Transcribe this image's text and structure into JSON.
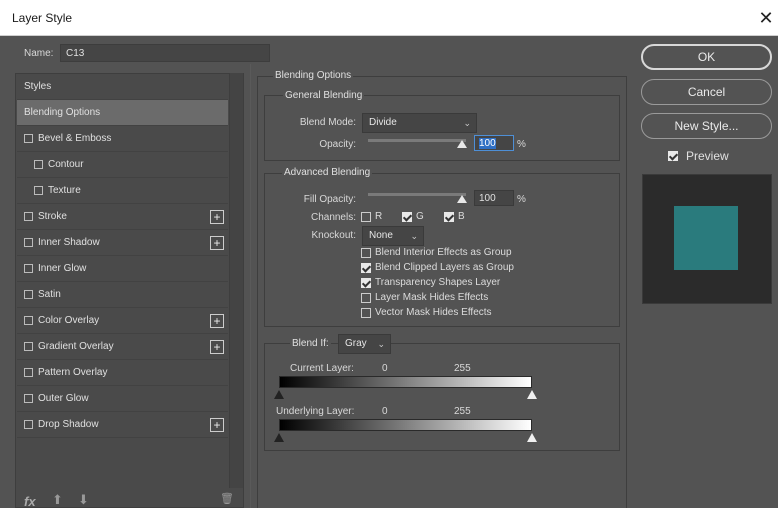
{
  "window": {
    "title": "Layer Style",
    "close_glyph": "✕"
  },
  "name_field": {
    "label": "Name:",
    "value": "C13"
  },
  "styles_list": {
    "header": "Styles",
    "items": [
      {
        "label": "Blending Options",
        "checkbox": false,
        "plus": false,
        "selected": true
      },
      {
        "label": "Bevel & Emboss",
        "checkbox": true,
        "plus": false
      },
      {
        "label": "Contour",
        "checkbox": true,
        "plus": false,
        "indent": true
      },
      {
        "label": "Texture",
        "checkbox": true,
        "plus": false,
        "indent": true
      },
      {
        "label": "Stroke",
        "checkbox": true,
        "plus": true
      },
      {
        "label": "Inner Shadow",
        "checkbox": true,
        "plus": true
      },
      {
        "label": "Inner Glow",
        "checkbox": true,
        "plus": false
      },
      {
        "label": "Satin",
        "checkbox": true,
        "plus": false
      },
      {
        "label": "Color Overlay",
        "checkbox": true,
        "plus": true
      },
      {
        "label": "Gradient Overlay",
        "checkbox": true,
        "plus": true
      },
      {
        "label": "Pattern Overlay",
        "checkbox": true,
        "plus": false
      },
      {
        "label": "Outer Glow",
        "checkbox": true,
        "plus": false
      },
      {
        "label": "Drop Shadow",
        "checkbox": true,
        "plus": true
      }
    ],
    "plus_glyph": "+"
  },
  "footer_icons": {
    "fx": "fx",
    "up": "⬆",
    "down": "⬇",
    "trash": "🗑"
  },
  "blending_options": {
    "title": "Blending Options",
    "general": {
      "title": "General Blending",
      "blend_mode_label": "Blend Mode:",
      "blend_mode_value": "Divide",
      "opacity_label": "Opacity:",
      "opacity_value": "100",
      "percent": "%"
    },
    "advanced": {
      "title": "Advanced Blending",
      "fill_opacity_label": "Fill Opacity:",
      "fill_opacity_value": "100",
      "percent": "%",
      "channels_label": "Channels:",
      "channel_r": "R",
      "channel_g": "G",
      "channel_b": "B",
      "knockout_label": "Knockout:",
      "knockout_value": "None",
      "options": [
        {
          "label": "Blend Interior Effects as Group",
          "checked": false
        },
        {
          "label": "Blend Clipped Layers as Group",
          "checked": true
        },
        {
          "label": "Transparency Shapes Layer",
          "checked": true
        },
        {
          "label": "Layer Mask Hides Effects",
          "checked": false
        },
        {
          "label": "Vector Mask Hides Effects",
          "checked": false
        }
      ]
    },
    "blend_if": {
      "label": "Blend If:",
      "value": "Gray",
      "current_layer_label": "Current Layer:",
      "current_min": "0",
      "current_max": "255",
      "underlying_layer_label": "Underlying Layer:",
      "underlying_min": "0",
      "underlying_max": "255"
    }
  },
  "buttons": {
    "ok": "OK",
    "cancel": "Cancel",
    "new_style": "New Style...",
    "preview_label": "Preview"
  },
  "colors": {
    "preview_swatch": "#2a7b7d",
    "panel_bg": "#535353"
  }
}
